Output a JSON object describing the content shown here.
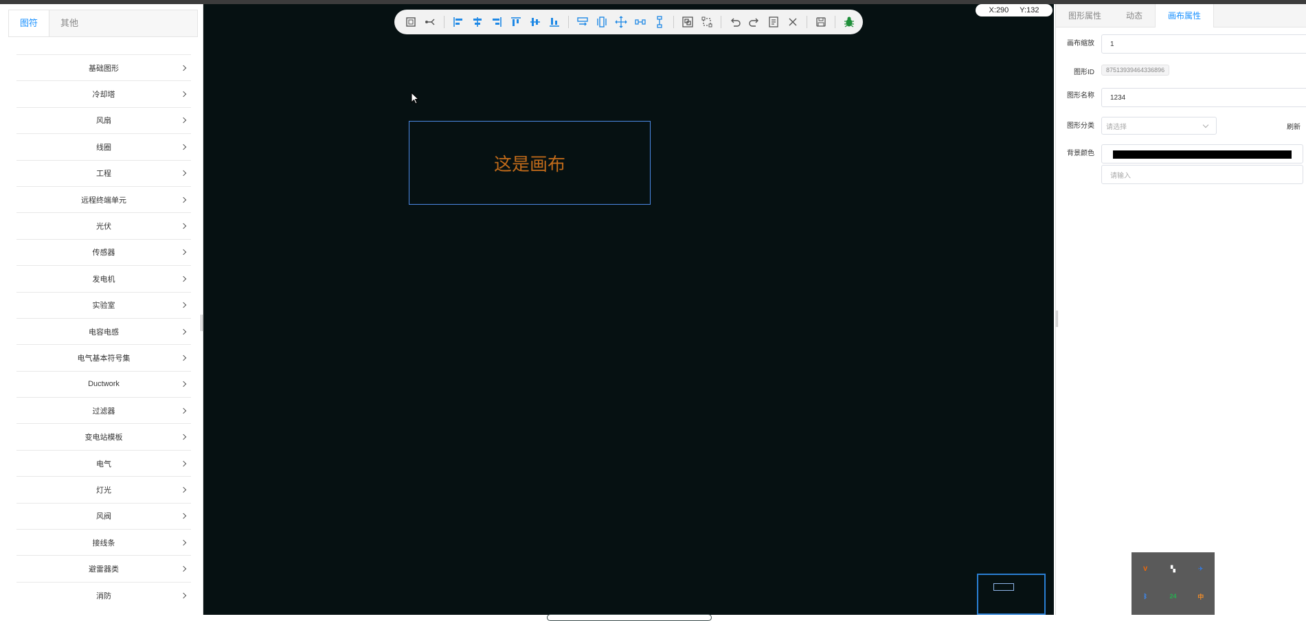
{
  "left_tabs": [
    {
      "label": "图符",
      "active": true
    },
    {
      "label": "其他",
      "active": false
    }
  ],
  "categories": [
    "基础图形",
    "冷却塔",
    "风扇",
    "线圈",
    "工程",
    "远程终端单元",
    "光伏",
    "传感器",
    "发电机",
    "实验室",
    "电容电感",
    "电气基本符号集",
    "Ductwork",
    "过滤器",
    "变电站模板",
    "电气",
    "灯光",
    "风阀",
    "接线条",
    "避雷器类",
    "消防"
  ],
  "toolbar": {
    "buttons": [
      "fit-screen-icon",
      "connect-icon",
      "align-left-icon",
      "align-center-icon",
      "align-right-icon",
      "align-top-icon",
      "align-middle-icon",
      "align-bottom-icon",
      "distribute-horizontal-icon",
      "distribute-vertical-icon",
      "move-icon",
      "space-horizontal-icon",
      "space-vertical-icon",
      "group-icon",
      "ungroup-icon",
      "undo-icon",
      "redo-icon",
      "document-icon",
      "delete-icon",
      "save-icon",
      "debug-icon"
    ]
  },
  "coords": {
    "x_label": "X:290",
    "y_label": "Y:132"
  },
  "canvas": {
    "text": "这是画布",
    "background": "#061112"
  },
  "right_tabs": [
    {
      "label": "图形属性",
      "active": false
    },
    {
      "label": "动态",
      "active": false
    },
    {
      "label": "画布属性",
      "active": true
    }
  ],
  "props": {
    "zoom_label": "画布缩放",
    "zoom_value": "1",
    "id_label": "图形ID",
    "id_value": "875139394643368​96",
    "name_label": "图形名称",
    "name_value": "1234",
    "category_label": "图形分类",
    "category_placeholder": "请选择",
    "refresh_label": "刷新",
    "bg_label": "背景颜色",
    "bg_color": "#000000",
    "bg_input_placeholder": "请输入"
  },
  "tray": {
    "items": [
      {
        "name": "app-v-icon",
        "glyph": "V",
        "color": "#ff6a00"
      },
      {
        "name": "bookmark-app-icon",
        "glyph": "▚",
        "color": "#ffffff"
      },
      {
        "name": "feishu-icon",
        "glyph": "✈",
        "color": "#2e7ff5"
      },
      {
        "name": "bluetooth-icon",
        "glyph": "ᛒ",
        "color": "#3a8dff"
      },
      {
        "name": "calendar-24-icon",
        "glyph": "24",
        "color": "#26b050"
      },
      {
        "name": "ime-zh-icon",
        "glyph": "中",
        "color": "#f08c2a"
      }
    ]
  }
}
